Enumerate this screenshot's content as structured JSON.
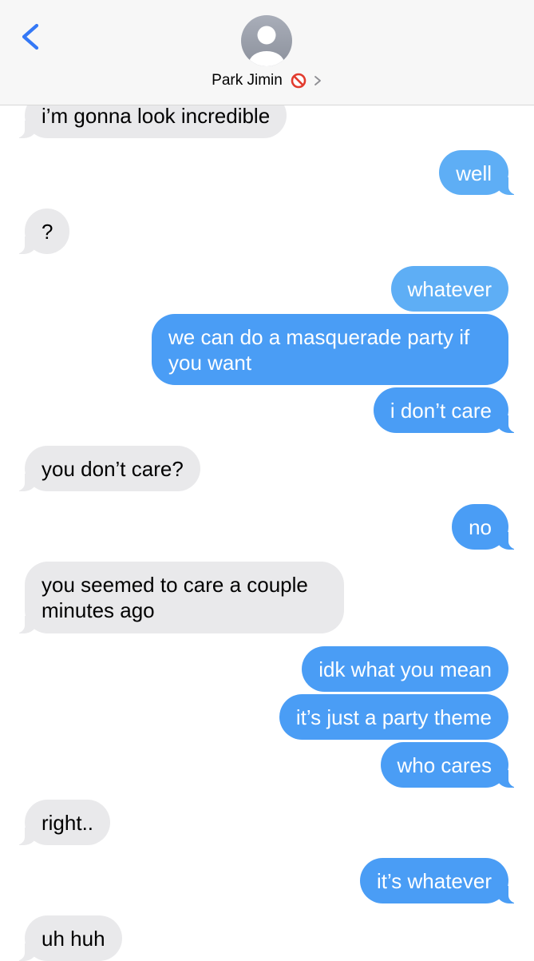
{
  "header": {
    "contact_name": "Park Jimin",
    "back_icon": "chevron-left-icon",
    "blocked_icon": "no-entry-icon",
    "detail_icon": "chevron-right-icon"
  },
  "colors": {
    "header_background": "#f7f7f7",
    "incoming_bubble": "#e9e9eb",
    "outgoing_bubble": "#4a9df5",
    "back_icon": "#3478f6",
    "blocked_icon": "#e23b2e"
  },
  "messages": [
    {
      "sender": "them",
      "text": "i’m gonna look incredible"
    },
    {
      "sender": "me",
      "text": "well"
    },
    {
      "sender": "them",
      "text": "?"
    },
    {
      "sender": "me",
      "text": "whatever"
    },
    {
      "sender": "me",
      "text": "we can do a masquerade party if you want"
    },
    {
      "sender": "me",
      "text": "i don’t care"
    },
    {
      "sender": "them",
      "text": "you don’t care?"
    },
    {
      "sender": "me",
      "text": "no"
    },
    {
      "sender": "them",
      "text": "you seemed to care a couple minutes ago"
    },
    {
      "sender": "me",
      "text": "idk what you mean"
    },
    {
      "sender": "me",
      "text": "it’s just a party theme"
    },
    {
      "sender": "me",
      "text": "who cares"
    },
    {
      "sender": "them",
      "text": "right.."
    },
    {
      "sender": "me",
      "text": "it’s whatever"
    },
    {
      "sender": "them",
      "text": "uh huh"
    }
  ]
}
